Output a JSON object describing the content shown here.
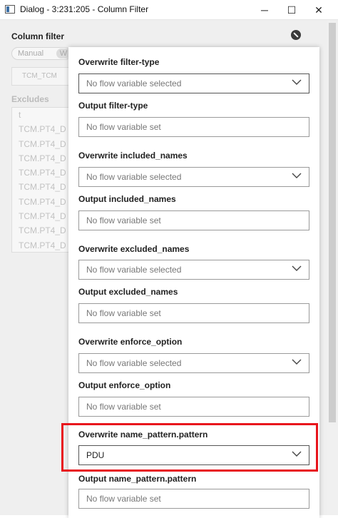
{
  "window": {
    "title": "Dialog - 3:231:205 - Column Filter",
    "minimize_glyph": "─",
    "maximize_glyph": "☐",
    "close_glyph": "✕"
  },
  "background": {
    "section_title": "Column filter",
    "toggle_manual": "Manual",
    "toggle_w": "W",
    "search_text": "TCM_TCM",
    "excludes_label": "Excludes",
    "excludes_items": [
      "t",
      "TCM.PT4_D",
      "TCM.PT4_D",
      "TCM.PT4_D",
      "TCM.PT4_D",
      "TCM.PT4_D",
      "TCM.PT4_D",
      "TCM.PT4_D",
      "TCM.PT4_D",
      "TCM.PT4_D"
    ]
  },
  "fields": [
    {
      "label": "Overwrite filter-type",
      "value": "No flow variable selected"
    },
    {
      "label": "Output filter-type",
      "value": "No flow variable set"
    },
    {
      "label": "Overwrite included_names",
      "value": "No flow variable selected"
    },
    {
      "label": "Output included_names",
      "value": "No flow variable set"
    },
    {
      "label": "Overwrite excluded_names",
      "value": "No flow variable selected"
    },
    {
      "label": "Output excluded_names",
      "value": "No flow variable set"
    },
    {
      "label": "Overwrite enforce_option",
      "value": "No flow variable selected"
    },
    {
      "label": "Output enforce_option",
      "value": "No flow variable set"
    },
    {
      "label": "Overwrite name_pattern.pattern",
      "value": "PDU"
    },
    {
      "label": "Output name_pattern.pattern",
      "value": "No flow variable set"
    }
  ],
  "colors": {
    "highlight": "#e8141c"
  }
}
